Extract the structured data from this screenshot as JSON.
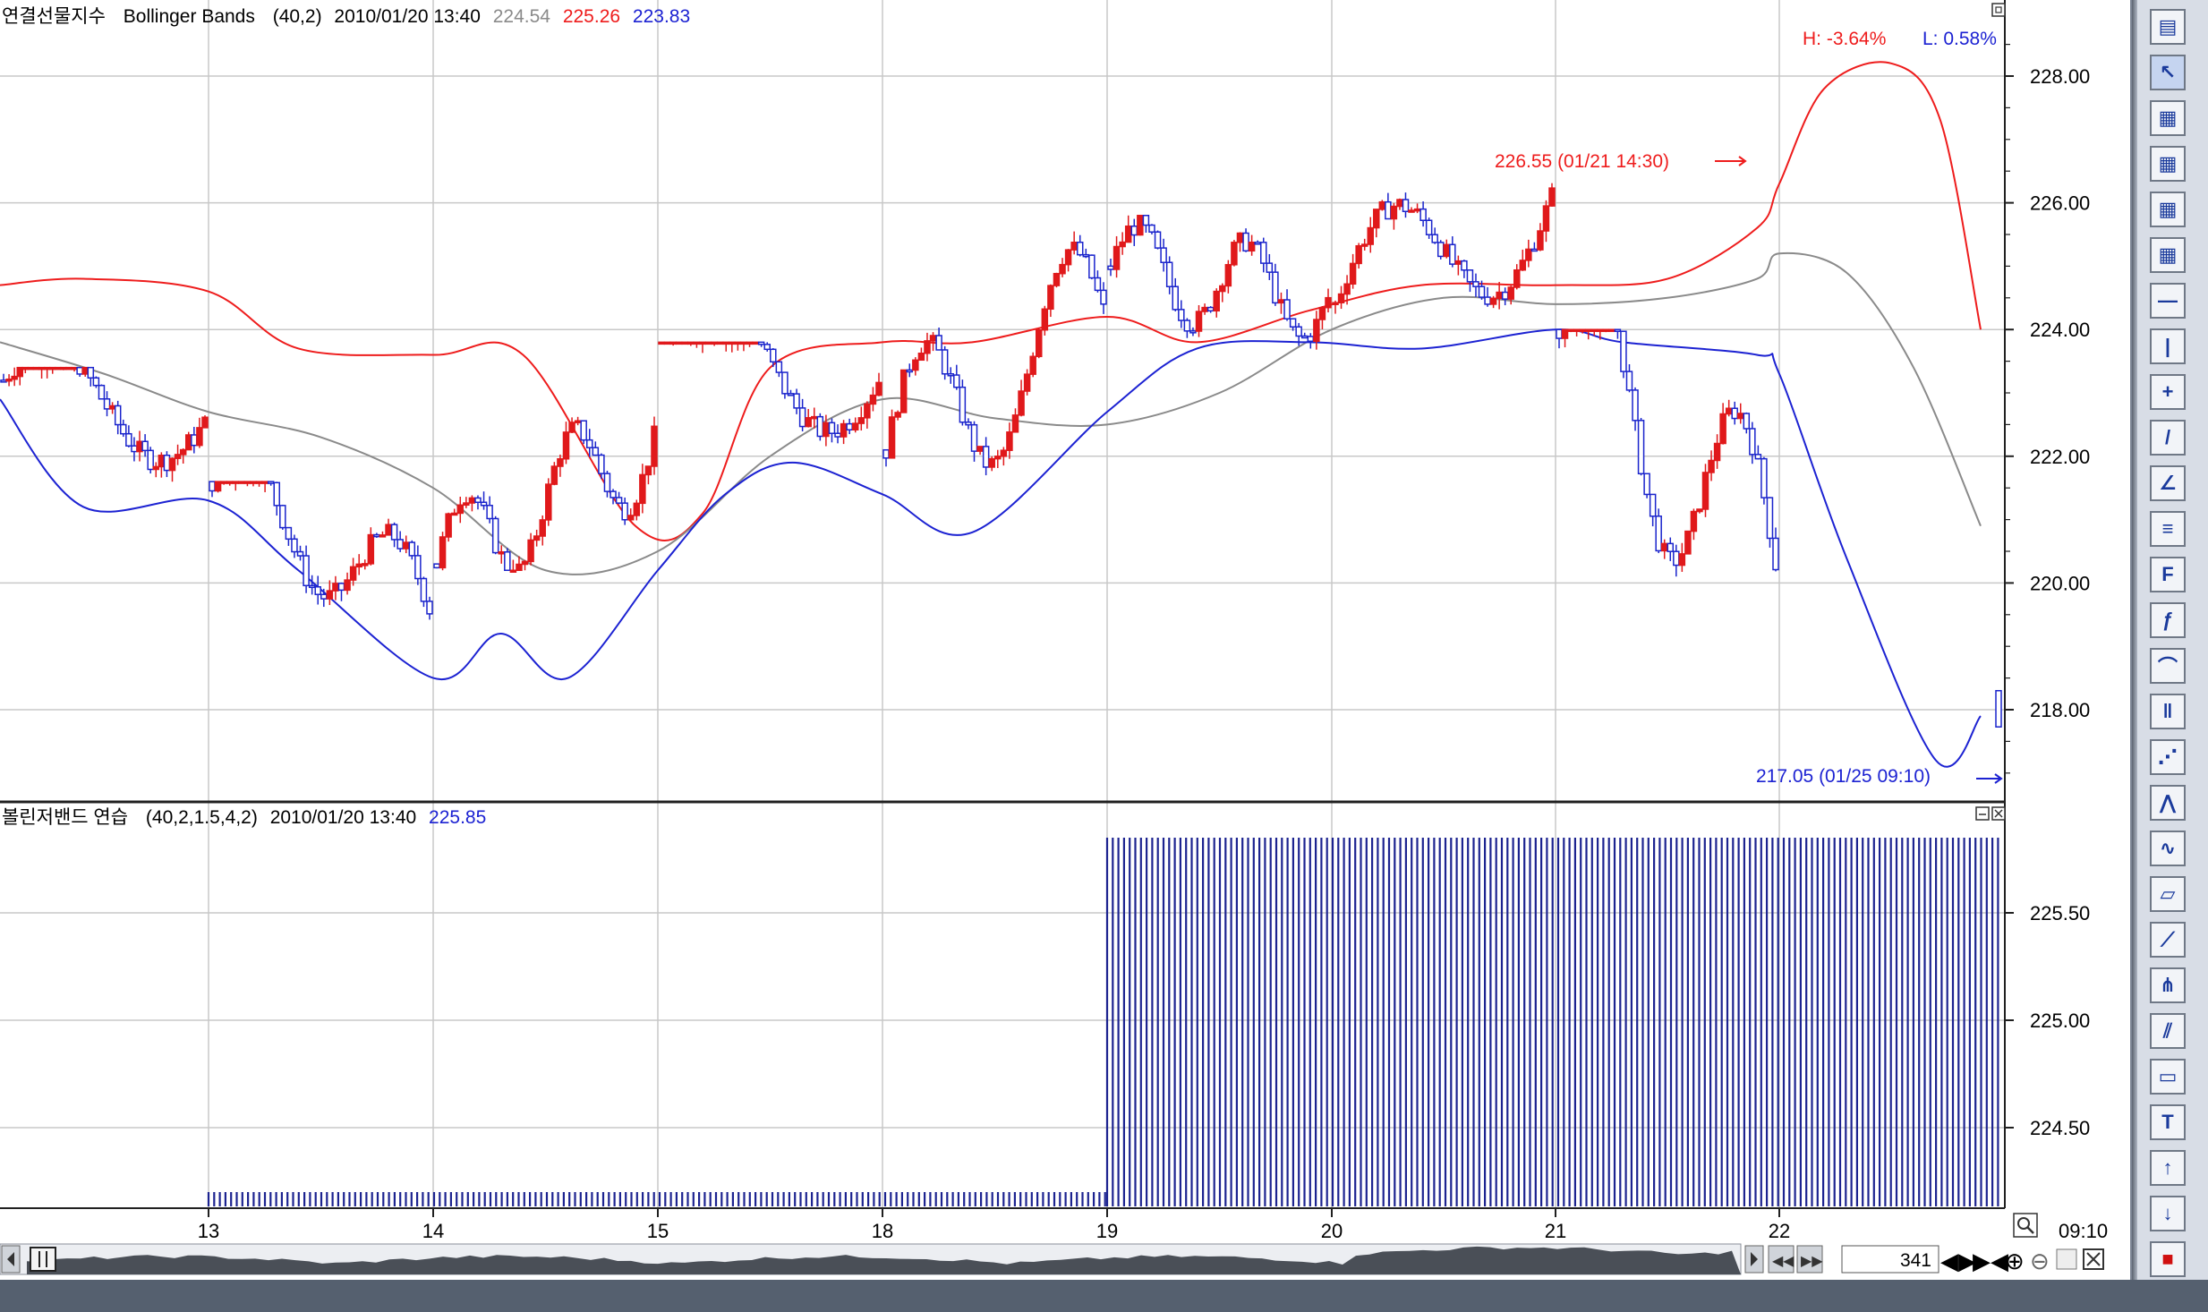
{
  "colors": {
    "upper_band": "#ee1c1c",
    "lower_band": "#1c22d2",
    "middle_band": "#8a8a8a",
    "candle_up": "#e0191b",
    "candle_down": "#1a24cc",
    "grid": "#c8c8c8",
    "histogram": "#1c2390"
  },
  "main_panel": {
    "instrument": "연결선물지수",
    "indicator": "Bollinger Bands",
    "params": "(40,2)",
    "datetime": "2010/01/20 13:40",
    "mid_value": "224.54",
    "upper_value": "225.26",
    "lower_value": "223.83",
    "high_pct": "H: -3.64%",
    "low_pct": "L: 0.58%",
    "high_annotation": "226.55 (01/21 14:30)",
    "low_annotation": "217.05 (01/25 09:10)",
    "y_ticks": [
      "228.00",
      "226.00",
      "224.00",
      "222.00",
      "220.00",
      "218.00"
    ]
  },
  "sub_panel": {
    "title": "볼린저밴드 연습",
    "params": "(40,2,1.5,4,2)",
    "datetime": "2010/01/20 13:40",
    "value": "225.85",
    "y_ticks": [
      "225.50",
      "225.00",
      "224.50"
    ]
  },
  "x_axis": {
    "labels": [
      "13",
      "14",
      "15",
      "18",
      "19",
      "20",
      "21",
      "22"
    ],
    "time": "09:10"
  },
  "scrollbar": {
    "bar_count": "341"
  },
  "chart_data": {
    "type": "candlestick",
    "title": "연결선물지수 Bollinger Bands (40,2)",
    "categories": [
      "13",
      "14",
      "15",
      "18",
      "19",
      "20",
      "21",
      "22"
    ],
    "ylim": [
      216.5,
      229.0
    ],
    "series": [
      {
        "name": "Upper",
        "x": [
          0,
          0.4,
          1,
          1.4,
          2,
          2.4,
          2.9,
          3.2,
          3.5,
          4,
          4.4,
          5,
          5.4,
          5.9,
          6.4,
          7,
          7.5,
          7.9,
          8.0,
          8.2,
          8.5,
          8.72,
          8.9
        ],
        "values": [
          224.7,
          224.8,
          224.6,
          223.7,
          223.6,
          223.6,
          220.9,
          221.1,
          223.4,
          223.8,
          223.8,
          224.2,
          223.8,
          224.3,
          224.7,
          224.7,
          224.8,
          225.6,
          226.3,
          227.8,
          228.2,
          227.3,
          224.0
        ]
      },
      {
        "name": "Middle",
        "x": [
          0,
          0.5,
          1,
          1.5,
          2,
          2.5,
          3,
          3.5,
          4,
          4.5,
          5,
          5.5,
          6,
          6.5,
          7,
          7.5,
          7.9,
          8.0,
          8.3,
          8.6,
          8.9
        ],
        "values": [
          223.8,
          223.3,
          222.7,
          222.3,
          221.5,
          220.2,
          220.5,
          222.0,
          222.9,
          222.6,
          222.5,
          223.0,
          224.0,
          224.5,
          224.4,
          224.5,
          224.8,
          225.2,
          224.9,
          223.4,
          220.9
        ]
      },
      {
        "name": "Lower",
        "x": [
          0,
          0.4,
          1,
          1.4,
          2,
          2.3,
          2.6,
          3,
          3.3,
          3.6,
          4,
          4.4,
          5,
          5.4,
          5.9,
          6.4,
          7,
          7.3,
          7.9,
          8.0,
          8.3,
          8.7,
          8.9
        ],
        "values": [
          222.9,
          221.2,
          221.3,
          220.2,
          218.5,
          219.2,
          218.5,
          220.2,
          221.4,
          221.9,
          221.4,
          220.8,
          222.7,
          223.7,
          223.8,
          223.7,
          224.0,
          223.8,
          223.6,
          223.3,
          220.4,
          217.2,
          217.9
        ]
      }
    ],
    "ohlc_summary": [
      {
        "day": "13",
        "open": 223.2,
        "high": 223.4,
        "low": 221.1,
        "close": 222.5
      },
      {
        "day": "14",
        "open": 221.6,
        "high": 221.6,
        "low": 219.1,
        "close": 219.6
      },
      {
        "day": "15",
        "open": 220.3,
        "high": 222.9,
        "low": 220.2,
        "close": 222.3
      },
      {
        "day": "18",
        "open": 223.8,
        "high": 223.8,
        "low": 220.8,
        "close": 223.2
      },
      {
        "day": "19",
        "open": 222.1,
        "high": 225.8,
        "low": 221.7,
        "close": 224.3
      },
      {
        "day": "20",
        "open": 225.0,
        "high": 225.8,
        "low": 223.6,
        "close": 224.5
      },
      {
        "day": "21",
        "open": 224.4,
        "high": 226.55,
        "low": 223.1,
        "close": 226.1
      },
      {
        "day": "22",
        "open": 224.0,
        "high": 224.0,
        "low": 218.5,
        "close": 220.3
      },
      {
        "day": "25",
        "open": 218.3,
        "high": 218.3,
        "low": 217.05,
        "close": 217.8
      }
    ],
    "indicator_panel": {
      "type": "bar",
      "name": "볼린저밴드 연습",
      "ylim": [
        224.2,
        226.0
      ],
      "segments": [
        {
          "from": "13",
          "to": "19",
          "value": 224.2
        },
        {
          "from": "19",
          "to": "22",
          "value": 225.85
        }
      ]
    },
    "grid": true
  },
  "toolbar": {
    "icons": [
      "panel-toggle-icon",
      "pointer-icon",
      "chart-tool-icon",
      "chart-tool-icon",
      "chart-tool-icon",
      "chart-tool-icon",
      "horizontal-line-icon",
      "vertical-line-icon",
      "cross-line-icon",
      "trend-line-icon",
      "angle-line-icon",
      "parallel-lines-icon",
      "fibonacci-icon",
      "fibonacci-fan-icon",
      "fibonacci-arc-icon",
      "fibonacci-time-icon",
      "gann-fan-icon",
      "andrews-icon",
      "cycle-icon",
      "channel-icon",
      "regression-icon",
      "speed-line-icon",
      "error-channel-icon",
      "text-box-icon",
      "text-icon",
      "arrow-up-icon",
      "arrow-down-icon",
      "stop-icon"
    ]
  }
}
